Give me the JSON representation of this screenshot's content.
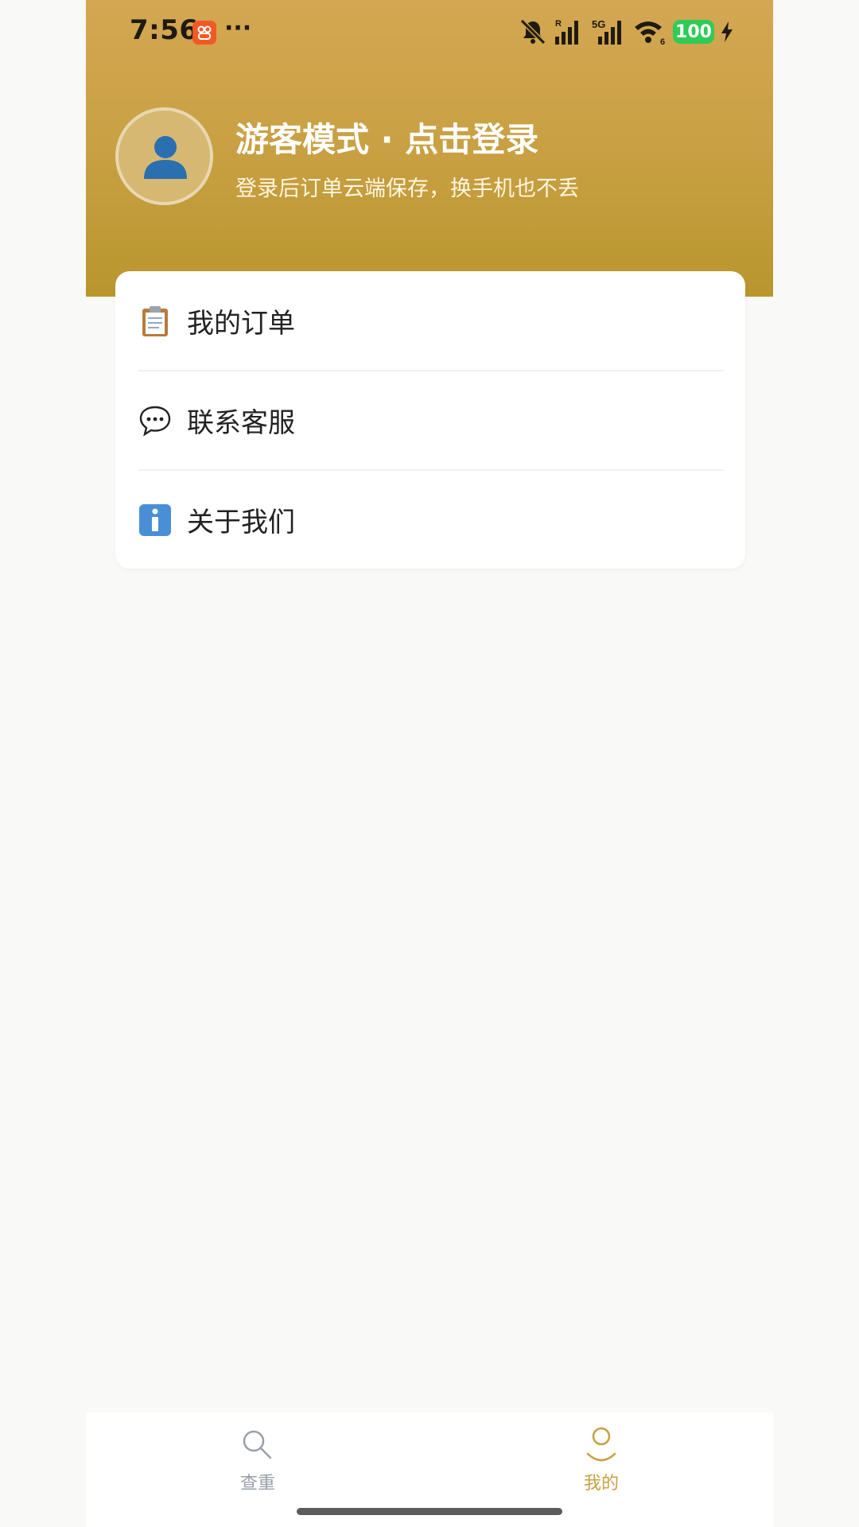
{
  "status_bar": {
    "time": "7:56",
    "dots": "···",
    "network_r": "R",
    "network_5g": "5G",
    "wifi_sub": "6",
    "battery": "100"
  },
  "profile": {
    "title": "游客模式 · 点击登录",
    "subtitle": "登录后订单云端保存，换手机也不丢"
  },
  "menu": {
    "items": [
      {
        "label": "我的订单",
        "icon": "clipboard-icon"
      },
      {
        "label": "联系客服",
        "icon": "speech-bubble-icon"
      },
      {
        "label": "关于我们",
        "icon": "info-icon"
      }
    ]
  },
  "bottom_nav": {
    "items": [
      {
        "label": "查重",
        "icon": "search-icon",
        "active": false
      },
      {
        "label": "我的",
        "icon": "user-icon",
        "active": true
      }
    ]
  },
  "colors": {
    "header_top": "#d4a752",
    "header_bottom": "#b8962e",
    "accent": "#c9a043",
    "battery": "#2fcb55",
    "inactive_nav": "#9aa0aa"
  }
}
